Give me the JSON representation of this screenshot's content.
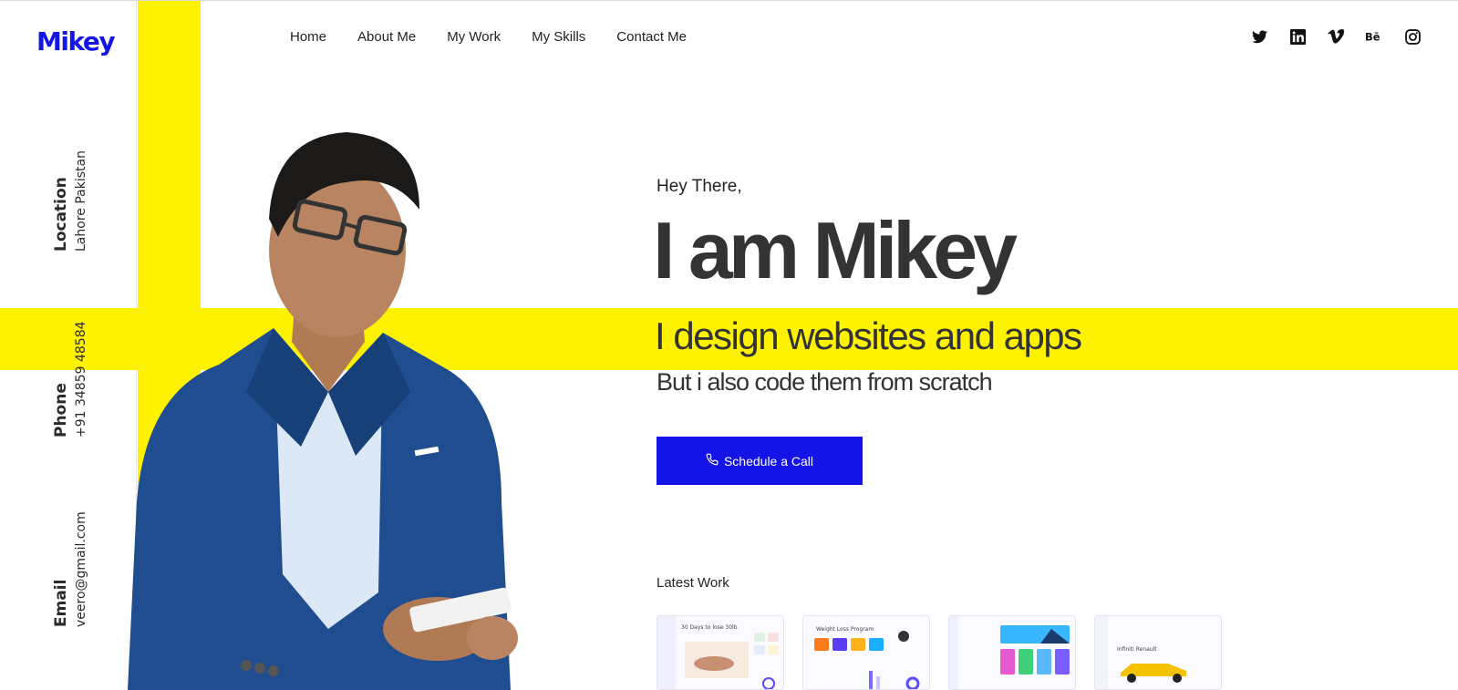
{
  "brand": {
    "logo": "Mikey",
    "accent": "#1414e6",
    "highlight": "#fff200"
  },
  "sidebar": {
    "location": {
      "label": "Location",
      "value": "Lahore Pakistan"
    },
    "phone": {
      "label": "Phone",
      "value": "+91 34859 48584"
    },
    "email": {
      "label": "Email",
      "value": "veero@gmail.com"
    }
  },
  "nav": {
    "items": [
      {
        "label": "Home"
      },
      {
        "label": "About Me"
      },
      {
        "label": "My Work"
      },
      {
        "label": "My Skills"
      },
      {
        "label": "Contact Me"
      }
    ]
  },
  "social": [
    "twitter-icon",
    "linkedin-icon",
    "vimeo-icon",
    "behance-icon",
    "instagram-icon"
  ],
  "hero": {
    "greeting": "Hey There,",
    "name": "I am Mikey",
    "tagline": "I design websites and apps",
    "subtagline": "But i also code them from scratch",
    "cta_label": "Schedule a Call"
  },
  "latest": {
    "label": "Latest Work",
    "items": [
      {
        "title": "30 Days to lose 30lb"
      },
      {
        "title": "Weight Loss Program"
      },
      {
        "title": ""
      },
      {
        "title": "Infiniti Renault"
      }
    ]
  }
}
